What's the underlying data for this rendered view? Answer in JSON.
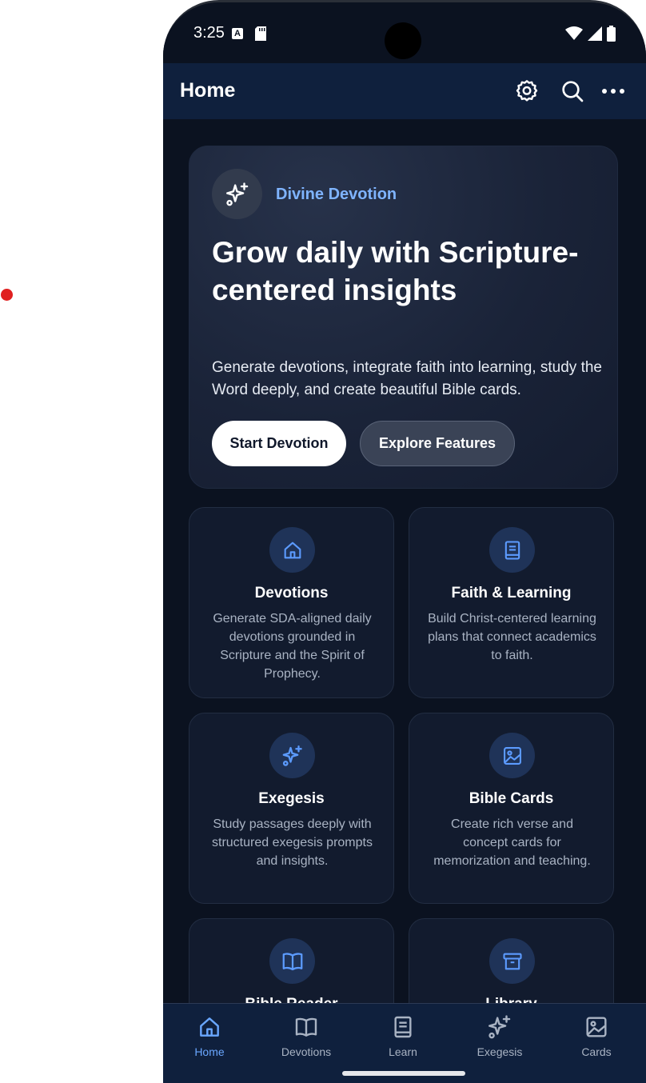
{
  "status_bar": {
    "time": "3:25",
    "notification_a": "A"
  },
  "app_bar": {
    "title": "Home",
    "icons": [
      "settings-icon",
      "search-icon",
      "more-icon"
    ]
  },
  "hero": {
    "brand": "Divine Devotion",
    "heading": "Grow daily with Scripture-centered insights",
    "subtitle": "Generate devotions, integrate faith into learning, study the Word deeply, and create beautiful Bible cards.",
    "primary_button": "Start Devotion",
    "secondary_button": "Explore Features"
  },
  "features": [
    {
      "icon": "home-icon",
      "title": "Devotions",
      "description": "Generate SDA-aligned daily devotions grounded in Scripture and the Spirit of Prophecy."
    },
    {
      "icon": "book-icon",
      "title": "Faith & Learning",
      "description": "Build Christ-centered learning plans that connect academics to faith."
    },
    {
      "icon": "sparkles-icon",
      "title": "Exegesis",
      "description": "Study passages deeply with structured exegesis prompts and insights."
    },
    {
      "icon": "image-icon",
      "title": "Bible Cards",
      "description": "Create rich verse and concept cards for memorization and teaching."
    },
    {
      "icon": "open-book-icon",
      "title": "Bible Reader",
      "description": ""
    },
    {
      "icon": "archive-icon",
      "title": "Library",
      "description": ""
    }
  ],
  "bottom_nav": {
    "active": "Home",
    "items": [
      {
        "label": "Home",
        "icon": "home-icon"
      },
      {
        "label": "Devotions",
        "icon": "open-book-icon"
      },
      {
        "label": "Learn",
        "icon": "book-icon"
      },
      {
        "label": "Exegesis",
        "icon": "sparkles-icon"
      },
      {
        "label": "Cards",
        "icon": "image-icon"
      }
    ]
  },
  "colors": {
    "background": "#0b1220",
    "app_bar": "#0f203d",
    "accent": "#6aa7ff",
    "brand_text": "#7fb4ff",
    "recording_dot": "#e02020"
  }
}
